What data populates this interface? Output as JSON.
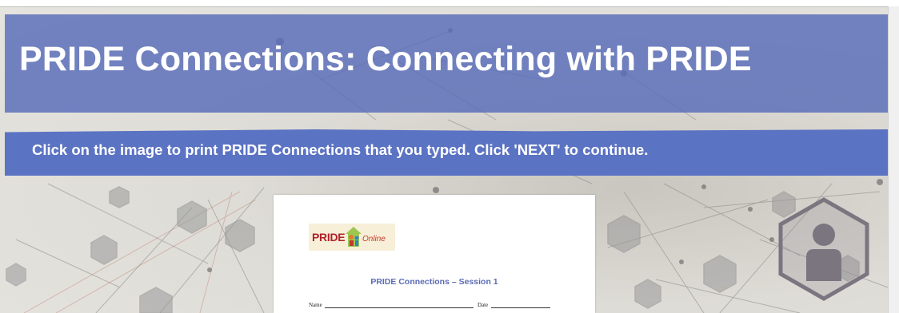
{
  "page": {
    "title": "PRIDE Connections: Connecting with PRIDE",
    "instruction": "Click on the image to print PRIDE Connections that you typed. Click 'NEXT' to continue."
  },
  "document_preview": {
    "logo": {
      "text": "PRIDE",
      "subtext": "Online"
    },
    "heading": "PRIDE Connections – Session 1",
    "fields": [
      {
        "label": "Name"
      },
      {
        "label": "Date"
      }
    ]
  },
  "colors": {
    "title_band": "#586bb8",
    "banner": "#5b73c3",
    "heading_text": "#5a6bb5",
    "logo_red": "#b0222a"
  },
  "icons": [
    "person-icon",
    "network-background"
  ]
}
